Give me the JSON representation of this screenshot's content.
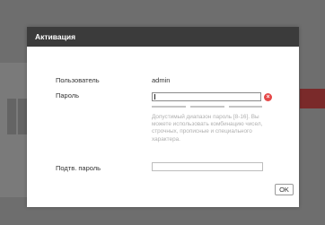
{
  "dialog": {
    "title": "Активация",
    "username_label": "Пользователь",
    "username_value": "admin",
    "password_label": "Пароль",
    "password_value": "",
    "password_hint": "Допустимый диапазон пароль [8-16]. Вы можете использовать комбинацию чисел, строчных, прописные и специального характера.",
    "confirm_label": "Подтв. пароль",
    "confirm_value": "",
    "ok_label": "OK",
    "error_icon": "error-x-icon",
    "error_color": "#e54848"
  }
}
